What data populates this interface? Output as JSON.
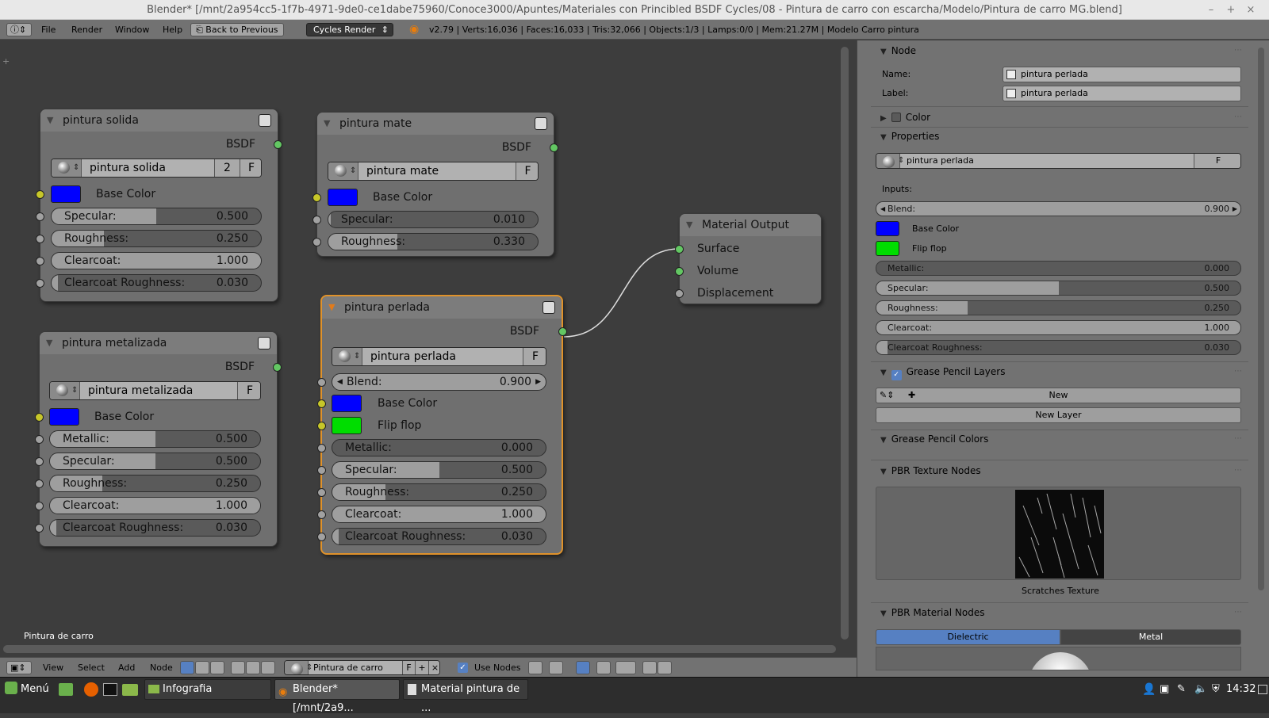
{
  "window": {
    "title": "Blender* [/mnt/2a954cc5-1f7b-4971-9de0-ce1dabe75960/Conoce3000/Apuntes/Materiales con Princibled BSDF Cycles/08 - Pintura de carro con escarcha/Modelo/Pintura de carro MG.blend]",
    "minimize": "–",
    "maximize": "+",
    "close": "×"
  },
  "infobar": {
    "menus": [
      "File",
      "Render",
      "Window",
      "Help"
    ],
    "back_button": "Back to Previous",
    "render_engine": "Cycles Render",
    "stats": "v2.79 | Verts:16,036 | Faces:16,033 | Tris:32,066 | Objects:1/3 | Lamps:0/0 | Mem:21.27M | Modelo Carro pintura"
  },
  "nodes": {
    "solida": {
      "title": "pintura solida",
      "output": "BSDF",
      "material": "pintura solida",
      "users": "2",
      "fake": "F",
      "base_color_label": "Base Color",
      "base_color": "#0000ff",
      "inputs": [
        {
          "label": "Specular:",
          "value": "0.500",
          "fill": 0.5
        },
        {
          "label": "Roughness:",
          "value": "0.250",
          "fill": 0.25
        },
        {
          "label": "Clearcoat:",
          "value": "1.000",
          "fill": 1.0
        },
        {
          "label": "Clearcoat Roughness:",
          "value": "0.030",
          "fill": 0.03
        }
      ]
    },
    "mate": {
      "title": "pintura mate",
      "output": "BSDF",
      "material": "pintura mate",
      "fake": "F",
      "base_color_label": "Base Color",
      "base_color": "#0000ff",
      "inputs": [
        {
          "label": "Specular:",
          "value": "0.010",
          "fill": 0.01
        },
        {
          "label": "Roughness:",
          "value": "0.330",
          "fill": 0.33
        }
      ]
    },
    "metalizada": {
      "title": "pintura metalizada",
      "output": "BSDF",
      "material": "pintura metalizada",
      "fake": "F",
      "base_color_label": "Base Color",
      "base_color": "#0000ff",
      "inputs": [
        {
          "label": "Metallic:",
          "value": "0.500",
          "fill": 0.5
        },
        {
          "label": "Specular:",
          "value": "0.500",
          "fill": 0.5
        },
        {
          "label": "Roughness:",
          "value": "0.250",
          "fill": 0.25
        },
        {
          "label": "Clearcoat:",
          "value": "1.000",
          "fill": 1.0
        },
        {
          "label": "Clearcoat Roughness:",
          "value": "0.030",
          "fill": 0.03
        }
      ]
    },
    "perlada": {
      "title": "pintura perlada",
      "output": "BSDF",
      "material": "pintura perlada",
      "fake": "F",
      "blend_label": "Blend:",
      "blend_value": "0.900",
      "base_color_label": "Base Color",
      "base_color": "#0000ff",
      "flip_label": "Flip flop",
      "flip_color": "#00dd00",
      "inputs": [
        {
          "label": "Metallic:",
          "value": "0.000",
          "fill": 0.0
        },
        {
          "label": "Specular:",
          "value": "0.500",
          "fill": 0.5
        },
        {
          "label": "Roughness:",
          "value": "0.250",
          "fill": 0.25
        },
        {
          "label": "Clearcoat:",
          "value": "1.000",
          "fill": 1.0
        },
        {
          "label": "Clearcoat Roughness:",
          "value": "0.030",
          "fill": 0.03
        }
      ]
    },
    "output": {
      "title": "Material Output",
      "sockets": [
        "Surface",
        "Volume",
        "Displacement"
      ]
    }
  },
  "editor": {
    "frame_label": "Pintura de carro"
  },
  "node_toolbar": {
    "menus": [
      "View",
      "Select",
      "Add",
      "Node"
    ],
    "material": "Pintura de carro",
    "fake": "F",
    "use_nodes": "Use Nodes"
  },
  "panel": {
    "node_header": "Node",
    "name_label": "Name:",
    "name_value": "pintura perlada",
    "label_label": "Label:",
    "label_value": "pintura perlada",
    "color_header": "Color",
    "properties_header": "Properties",
    "material": "pintura perlada",
    "fake": "F",
    "inputs_label": "Inputs:",
    "blend_label": "Blend:",
    "blend_value": "0.900",
    "base_color_label": "Base Color",
    "flip_label": "Flip flop",
    "sliders": [
      {
        "label": "Metallic:",
        "value": "0.000",
        "fill": 0.0
      },
      {
        "label": "Specular:",
        "value": "0.500",
        "fill": 0.5
      },
      {
        "label": "Roughness:",
        "value": "0.250",
        "fill": 0.25
      },
      {
        "label": "Clearcoat:",
        "value": "1.000",
        "fill": 1.0
      },
      {
        "label": "Clearcoat Roughness:",
        "value": "0.030",
        "fill": 0.03
      }
    ],
    "gp_layers_header": "Grease Pencil Layers",
    "gp_new": "New",
    "gp_new_layer": "New Layer",
    "gp_colors_header": "Grease Pencil Colors",
    "pbr_texture_header": "PBR Texture Nodes",
    "texture_caption": "Scratches Texture",
    "pbr_material_header": "PBR Material Nodes",
    "tab_dielectric": "Dielectric",
    "tab_metal": "Metal"
  },
  "taskbar": {
    "menu": "Menú",
    "tasks": [
      "Infografia",
      "Blender* [/mnt/2a9...",
      "Material pintura de ..."
    ],
    "clock": "14:32"
  },
  "colors": {
    "accent_blue": "#5680c2",
    "active_node_border": "#e0922a",
    "socket_green": "#63c763",
    "socket_yellow": "#c7c729",
    "socket_grey": "#a1a1a1"
  }
}
